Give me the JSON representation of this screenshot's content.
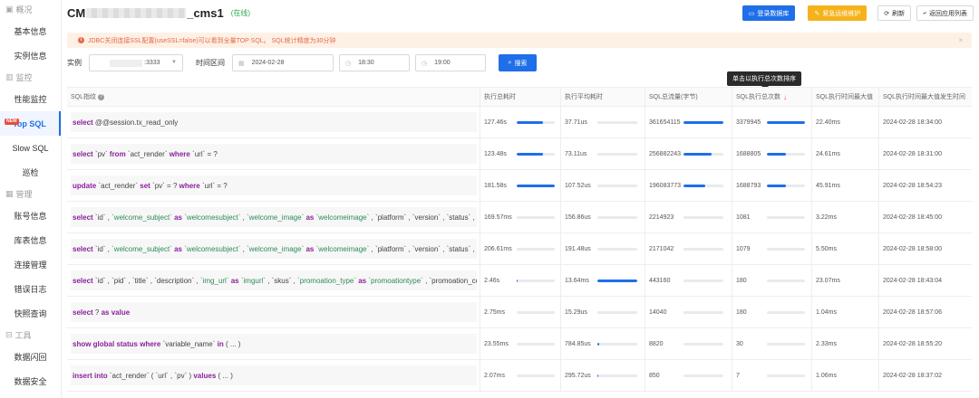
{
  "colors": {
    "accent": "#1e6fe8",
    "warn": "#f5b21b",
    "online": "#2aab4e",
    "keyword": "#8b1f9c",
    "string": "#2e8b57",
    "notice_text": "#e8684a",
    "sort_arrow": "#e94b3c"
  },
  "sidebar": {
    "groups": [
      {
        "label": "概况",
        "icon": "overview-icon",
        "items": [
          "基本信息",
          "实例信息"
        ]
      },
      {
        "label": "监控",
        "icon": "chart-icon",
        "items": [
          "性能监控",
          "Top SQL",
          "Slow SQL",
          "巡检"
        ]
      },
      {
        "label": "管理",
        "icon": "grid-icon",
        "items": [
          "账号信息",
          "库表信息",
          "连接管理",
          "错误日志",
          "快照查询"
        ]
      },
      {
        "label": "工具",
        "icon": "toolbox-icon",
        "items": [
          "数据闪回",
          "数据安全"
        ]
      }
    ],
    "active": "Top SQL",
    "new_badge": "NEW"
  },
  "header": {
    "title_prefix": "CM",
    "title_suffix": "_cms1",
    "status": "(在线)",
    "buttons": [
      "登录数据库",
      "紧急运维维护",
      "刷新",
      "返回应用列表"
    ]
  },
  "notice": {
    "icon": "i",
    "text": "JDBC关闭连接SSL配置(useSSL=false)可以看到全量TOP SQL。 SQL统计精度为30分钟",
    "close": "×"
  },
  "filters": {
    "instance_label": "实例",
    "instance_value": ":3333",
    "range_label": "时间区间",
    "date": "2024-02-28",
    "time_start": "18:30",
    "time_end": "19:00",
    "search_label": "搜索"
  },
  "tooltip": "单击以执行总次数排序",
  "table": {
    "headers": [
      "SQL指纹",
      "执行总耗时",
      "执行平均耗时",
      "SQL总流量(字节)",
      "SQL执行总次数",
      "SQL执行时间最大值",
      "SQL执行时间最大值发生时间"
    ],
    "sort_arrow": "↓",
    "rows": [
      {
        "sql": [
          [
            "k",
            "select "
          ],
          [
            "p",
            "@@session.tx_read_only"
          ]
        ],
        "total": "127.46s",
        "total_pct": 0.7,
        "avg": "37.71us",
        "avg_pct": 0.0,
        "flow": "361654115",
        "flow_pct": 1.0,
        "count": "3379945",
        "count_pct": 1.0,
        "max": "22.40ms",
        "max_time": "2024-02-28 18:34:00"
      },
      {
        "sql": [
          [
            "k",
            "select "
          ],
          [
            "p",
            "`pv` "
          ],
          [
            "k",
            "from "
          ],
          [
            "p",
            "`act_render` "
          ],
          [
            "k",
            "where "
          ],
          [
            "p",
            "`url` = ?"
          ]
        ],
        "total": "123.48s",
        "total_pct": 0.68,
        "avg": "73.11us",
        "avg_pct": 0.0,
        "flow": "256882243",
        "flow_pct": 0.71,
        "count": "1688805",
        "count_pct": 0.5,
        "max": "24.61ms",
        "max_time": "2024-02-28 18:31:00"
      },
      {
        "sql": [
          [
            "k",
            "update "
          ],
          [
            "p",
            "`act_render` "
          ],
          [
            "k",
            "set "
          ],
          [
            "p",
            "`pv` = ? "
          ],
          [
            "k",
            "where "
          ],
          [
            "p",
            "`url` = ?"
          ]
        ],
        "total": "181.58s",
        "total_pct": 1.0,
        "avg": "107.52us",
        "avg_pct": 0.0,
        "flow": "196083773",
        "flow_pct": 0.54,
        "count": "1688793",
        "count_pct": 0.5,
        "max": "45.91ms",
        "max_time": "2024-02-28 18:54:23"
      },
      {
        "sql": [
          [
            "k",
            "select "
          ],
          [
            "p",
            "`id` , "
          ],
          [
            "s",
            "`welcome_subject` "
          ],
          [
            "k",
            "as "
          ],
          [
            "s",
            "`welcomesubject` "
          ],
          [
            "p",
            ", "
          ],
          [
            "s",
            "`welcome_image` "
          ],
          [
            "k",
            "as "
          ],
          [
            "s",
            "`welcomeimage` "
          ],
          [
            "p",
            ", `platform` , `version` , `status` , `..."
          ]
        ],
        "total": "169.57ms",
        "total_pct": 0.0,
        "avg": "156.86us",
        "avg_pct": 0.0,
        "flow": "2214923",
        "flow_pct": 0.0,
        "count": "1081",
        "count_pct": 0.0,
        "max": "3.22ms",
        "max_time": "2024-02-28 18:45:00"
      },
      {
        "sql": [
          [
            "k",
            "select "
          ],
          [
            "p",
            "`id` , "
          ],
          [
            "s",
            "`welcome_subject` "
          ],
          [
            "k",
            "as "
          ],
          [
            "s",
            "`welcomesubject` "
          ],
          [
            "p",
            ", "
          ],
          [
            "s",
            "`welcome_image` "
          ],
          [
            "k",
            "as "
          ],
          [
            "s",
            "`welcomeimage` "
          ],
          [
            "p",
            ", `platform` , `version` , `status` , `..."
          ]
        ],
        "total": "206.61ms",
        "total_pct": 0.0,
        "avg": "191.48us",
        "avg_pct": 0.0,
        "flow": "2171042",
        "flow_pct": 0.0,
        "count": "1079",
        "count_pct": 0.0,
        "max": "5.50ms",
        "max_time": "2024-02-28 18:58:00"
      },
      {
        "sql": [
          [
            "k",
            "select "
          ],
          [
            "p",
            "`id` , `pid` , `title` , `description` , "
          ],
          [
            "s",
            "`img_url` "
          ],
          [
            "k",
            "as "
          ],
          [
            "s",
            "`imgurl` "
          ],
          [
            "p",
            ", `skus` , "
          ],
          [
            "s",
            "`promoation_type` "
          ],
          [
            "k",
            "as "
          ],
          [
            "s",
            "`promoationtype` "
          ],
          [
            "p",
            ", `promoation_co..."
          ]
        ],
        "total": "2.46s",
        "total_pct": 0.01,
        "avg": "13.64ms",
        "avg_pct": 1.0,
        "flow": "443160",
        "flow_pct": 0.0,
        "count": "180",
        "count_pct": 0.0,
        "max": "23.07ms",
        "max_time": "2024-02-28 18:43:04"
      },
      {
        "sql": [
          [
            "k",
            "select "
          ],
          [
            "p",
            "? "
          ],
          [
            "k",
            "as value"
          ]
        ],
        "total": "2.75ms",
        "total_pct": 0.0,
        "avg": "15.29us",
        "avg_pct": 0.0,
        "flow": "14040",
        "flow_pct": 0.0,
        "count": "180",
        "count_pct": 0.0,
        "max": "1.04ms",
        "max_time": "2024-02-28 18:57:06"
      },
      {
        "sql": [
          [
            "k",
            "show global status where "
          ],
          [
            "p",
            "`variable_name` "
          ],
          [
            "k",
            "in "
          ],
          [
            "p",
            "( ... )"
          ]
        ],
        "total": "23.55ms",
        "total_pct": 0.0,
        "avg": "784.85us",
        "avg_pct": 0.05,
        "flow": "8820",
        "flow_pct": 0.0,
        "count": "30",
        "count_pct": 0.0,
        "max": "2.33ms",
        "max_time": "2024-02-28 18:55:20"
      },
      {
        "sql": [
          [
            "k",
            "insert into "
          ],
          [
            "p",
            "`act_render` ( `url` , `pv` ) "
          ],
          [
            "k",
            "values "
          ],
          [
            "p",
            "( ... )"
          ]
        ],
        "total": "2.07ms",
        "total_pct": 0.0,
        "avg": "295.72us",
        "avg_pct": 0.02,
        "flow": "850",
        "flow_pct": 0.0,
        "count": "7",
        "count_pct": 0.0,
        "max": "1.06ms",
        "max_time": "2024-02-28 18:37:02"
      }
    ]
  }
}
